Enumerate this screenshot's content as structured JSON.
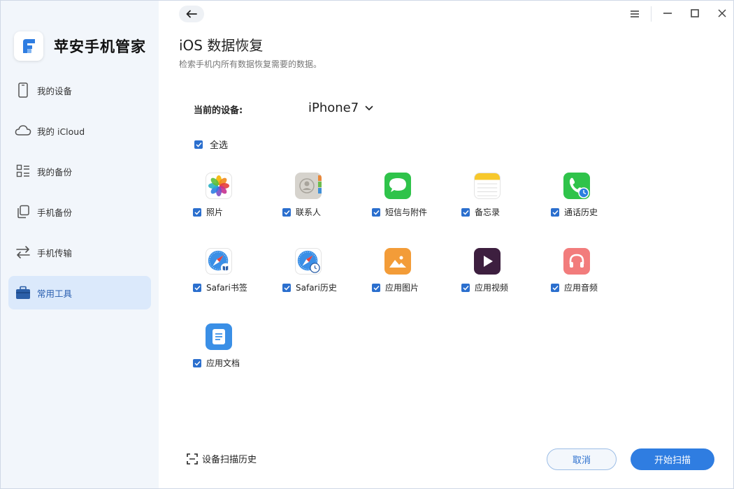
{
  "app": {
    "name": "苹安手机管家",
    "accent": "#2f7de1"
  },
  "sidebar": {
    "items": [
      {
        "label": "我的设备",
        "icon": "phone-icon",
        "active": false
      },
      {
        "label": "我的 iCloud",
        "icon": "cloud-icon",
        "active": false
      },
      {
        "label": "我的备份",
        "icon": "backup-list-icon",
        "active": false
      },
      {
        "label": "手机备份",
        "icon": "copy-icon",
        "active": false
      },
      {
        "label": "手机传输",
        "icon": "transfer-icon",
        "active": false
      },
      {
        "label": "常用工具",
        "icon": "toolbox-icon",
        "active": true
      }
    ]
  },
  "page": {
    "title": "iOS 数据恢复",
    "subtitle": "检索手机内所有数据恢复需要的数据。"
  },
  "device": {
    "label": "当前的设备:",
    "selected": "iPhone7"
  },
  "select_all": {
    "label": "全选",
    "checked": true
  },
  "categories": [
    {
      "label": "照片",
      "icon": "photos-icon",
      "checked": true
    },
    {
      "label": "联系人",
      "icon": "contacts-icon",
      "checked": true
    },
    {
      "label": "短信与附件",
      "icon": "messages-icon",
      "checked": true
    },
    {
      "label": "备忘录",
      "icon": "notes-icon",
      "checked": true
    },
    {
      "label": "通话历史",
      "icon": "call-history-icon",
      "checked": true
    },
    {
      "label": "Safari书签",
      "icon": "safari-bookmarks-icon",
      "checked": true
    },
    {
      "label": "Safari历史",
      "icon": "safari-history-icon",
      "checked": true
    },
    {
      "label": "应用图片",
      "icon": "app-photos-icon",
      "checked": true
    },
    {
      "label": "应用视频",
      "icon": "app-videos-icon",
      "checked": true
    },
    {
      "label": "应用音频",
      "icon": "app-audio-icon",
      "checked": true
    },
    {
      "label": "应用文档",
      "icon": "app-documents-icon",
      "checked": true
    }
  ],
  "footer": {
    "history_label": "设备扫描历史",
    "cancel_label": "取消",
    "scan_label": "开始扫描"
  }
}
